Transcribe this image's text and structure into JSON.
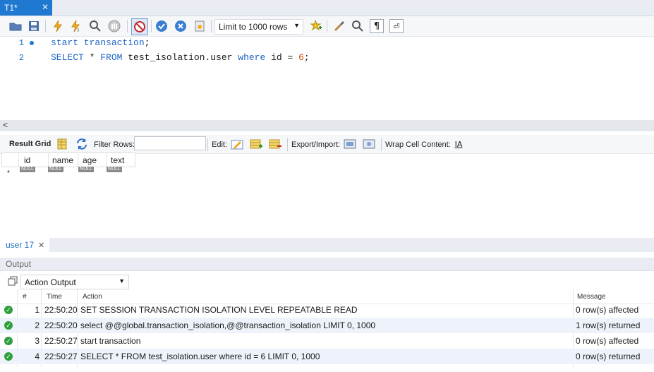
{
  "tabs": {
    "active_label": "T1*",
    "close_glyph": "✕"
  },
  "toolbar": {
    "limit_value": "Limit to 1000 rows",
    "icons": [
      "open-folder-icon",
      "save-icon",
      "execute-icon",
      "execute-current-icon",
      "explain-icon",
      "stop-icon",
      "toggle-autocommit-icon",
      "commit-icon",
      "rollback-icon",
      "beautify-icon",
      "limit-select",
      "bookmark-icon",
      "brush-icon",
      "find-icon",
      "invisible-chars-icon",
      "wrap-icon"
    ]
  },
  "editor": {
    "lines": [
      {
        "num": "1",
        "text": "start transaction;"
      },
      {
        "num": "2",
        "text": "SELECT * FROM test_isolation.user where id = 6;"
      }
    ],
    "line2_parts": {
      "kw1": "SELECT",
      "star": " * ",
      "kw2": "FROM",
      "table": " test_isolation.user ",
      "kw3": "where",
      "col": " id = ",
      "num": "6",
      "end": ";"
    },
    "line1_parts": {
      "kw": "start transaction",
      "end": ";"
    },
    "hscroll_arrow": "<"
  },
  "result_toolbar": {
    "result_grid": "Result Grid",
    "filter_rows": "Filter Rows:",
    "edit": "Edit:",
    "export_import": "Export/Import:",
    "wrap_cell": "Wrap Cell Content:"
  },
  "grid": {
    "columns": [
      "id",
      "name",
      "age",
      "text"
    ],
    "null_label": "NULL",
    "new_row_marker": "*"
  },
  "result_tabs": {
    "user_tab": "user 17",
    "close_glyph": "✕"
  },
  "output": {
    "header": "Output",
    "select_value": "Action Output",
    "columns": {
      "num": "#",
      "time": "Time",
      "action": "Action",
      "message": "Message"
    },
    "rows": [
      {
        "num": "1",
        "time": "22:50:20",
        "action": "SET SESSION TRANSACTION ISOLATION LEVEL REPEATABLE READ",
        "message": "0 row(s) affected"
      },
      {
        "num": "2",
        "time": "22:50:20",
        "action": "select @@global.transaction_isolation,@@transaction_isolation LIMIT 0, 1000",
        "message": "1 row(s) returned"
      },
      {
        "num": "3",
        "time": "22:50:27",
        "action": "start transaction",
        "message": "0 row(s) affected"
      },
      {
        "num": "4",
        "time": "22:50:27",
        "action": "SELECT * FROM test_isolation.user where id = 6 LIMIT 0, 1000",
        "message": "0 row(s) returned"
      }
    ],
    "ok_glyph": "✓"
  },
  "colors": {
    "accent": "#1f79d1",
    "ok": "#2f9e3d",
    "row_alt": "#eef3fb"
  }
}
